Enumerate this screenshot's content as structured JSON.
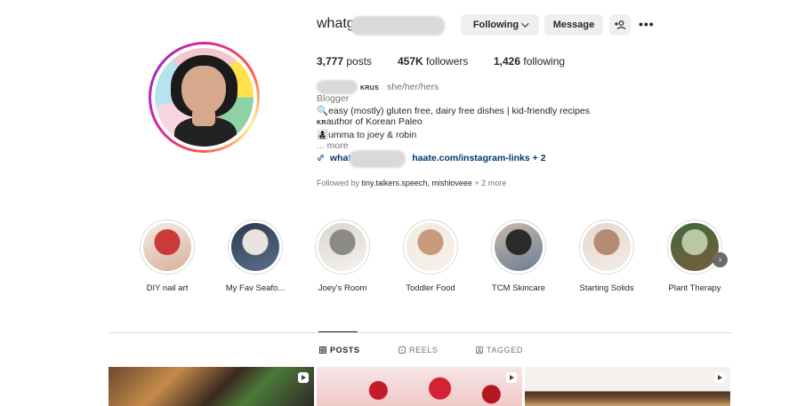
{
  "profile": {
    "username_start": "whatg",
    "username_end": "e",
    "following_label": "Following",
    "message_label": "Message",
    "add_user_icon": "person-plus-icon",
    "more_icon": "more-dots-icon"
  },
  "stats": {
    "posts_count": "3,777",
    "posts_label": "posts",
    "followers_count": "457K",
    "followers_label": "followers",
    "following_count": "1,426",
    "following_label": "following"
  },
  "bio": {
    "krus_badge": "KRUS",
    "pronouns": "she/her/hers",
    "category": "Blogger",
    "line1_emoji": "🔍",
    "line1": "easy (mostly) gluten free, dairy free dishes | kid-friendly recipes",
    "line2_prefix": "KR",
    "line2": "author of Korean Paleo",
    "line3_emoji": "👩‍👧‍👦",
    "line3": "umma to joey & robin",
    "more": "... more",
    "link_start": "whatg",
    "link_end": "haate.com/instagram-links + 2",
    "followed_prefix": "Followed by",
    "followed_names": "tiny.talkers.speech, mishloveee",
    "followed_suffix": "+ 2 more"
  },
  "highlights": [
    {
      "label": "DIY nail art",
      "colors": [
        "#f3ece6",
        "#c93a3a",
        "#d8b09a"
      ]
    },
    {
      "label": "My Fav Seafo...",
      "colors": [
        "#2d3a4d",
        "#e8e3dc",
        "#5b6f8c"
      ]
    },
    {
      "label": "Joey's Room",
      "colors": [
        "#d9d6d0",
        "#8c8a86",
        "#f5f2ed"
      ]
    },
    {
      "label": "Toddler Food",
      "colors": [
        "#f2e9e0",
        "#c79a7a",
        "#f7f1ea"
      ]
    },
    {
      "label": "TCM Skincare",
      "colors": [
        "#c9b8ad",
        "#2a2a2a",
        "#6c7d93"
      ]
    },
    {
      "label": "Starting Solids",
      "colors": [
        "#e6d8cf",
        "#b48c74",
        "#f3ece6"
      ]
    },
    {
      "label": "Plant Therapy",
      "colors": [
        "#3f6a3a",
        "#b9c9a6",
        "#7a5c3d"
      ]
    }
  ],
  "tabs": [
    {
      "label": "POSTS",
      "icon": "grid-icon",
      "active": true
    },
    {
      "label": "REELS",
      "icon": "reels-icon",
      "active": false
    },
    {
      "label": "TAGGED",
      "icon": "tagged-icon",
      "active": false
    }
  ],
  "posts": [
    {
      "type": "reel",
      "icon": "play-icon"
    },
    {
      "type": "reel",
      "icon": "play-icon"
    },
    {
      "type": "reel",
      "icon": "play-icon"
    }
  ],
  "colors": {
    "link": "#00376b",
    "button_bg": "#efefef",
    "muted_text": "#737373",
    "divider": "#dbdbdb"
  }
}
